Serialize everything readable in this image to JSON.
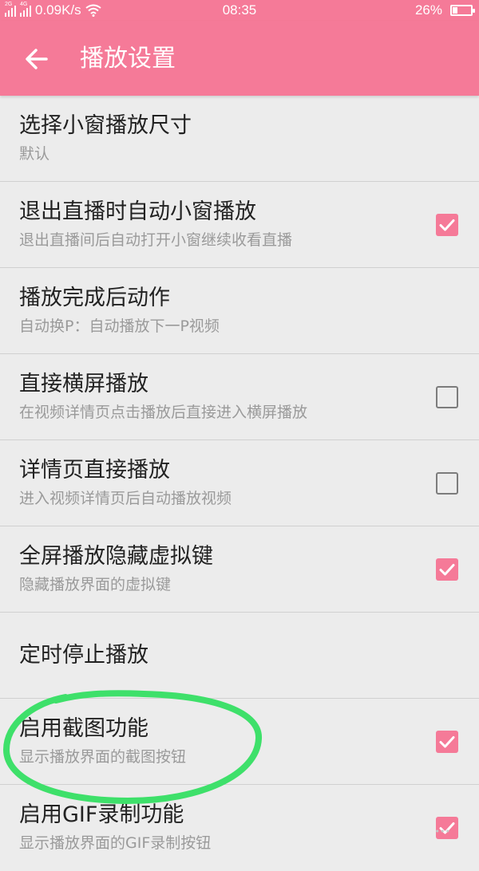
{
  "status_bar": {
    "signal_1_tag": "2G",
    "signal_2_tag": "4G",
    "network_speed": "0.09K/s",
    "wifi_icon": "wifi-icon",
    "time": "08:35",
    "battery_percent_text": "26%",
    "battery_level": 0.26
  },
  "app_bar": {
    "back_icon": "arrow-left-icon",
    "title": "播放设置",
    "background_color": "#f57a98"
  },
  "settings": {
    "items": [
      {
        "title": "选择小窗播放尺寸",
        "subtitle": "默认"
      },
      {
        "title": "退出直播时自动小窗播放",
        "subtitle": "退出直播间后自动打开小窗继续收看直播",
        "checked": true
      },
      {
        "title": "播放完成后动作",
        "subtitle": "自动换P：自动播放下一P视频"
      },
      {
        "title": "直接横屏播放",
        "subtitle": "在视频详情页点击播放后直接进入横屏播放",
        "checked": false
      },
      {
        "title": "详情页直接播放",
        "subtitle": "进入视频详情页后自动播放视频",
        "checked": false
      },
      {
        "title": "全屏播放隐藏虚拟键",
        "subtitle": "隐藏播放界面的虚拟键",
        "checked": true
      },
      {
        "title": "定时停止播放"
      },
      {
        "title": "启用截图功能",
        "subtitle": "显示播放界面的截图按钮",
        "checked": true
      },
      {
        "title": "启用GIF录制功能",
        "subtitle": "显示播放界面的GIF录制按钮",
        "checked": true
      }
    ]
  },
  "colors": {
    "accent": "#f57a98",
    "annotation_circle": "#3ee06a",
    "background": "#ececec"
  }
}
